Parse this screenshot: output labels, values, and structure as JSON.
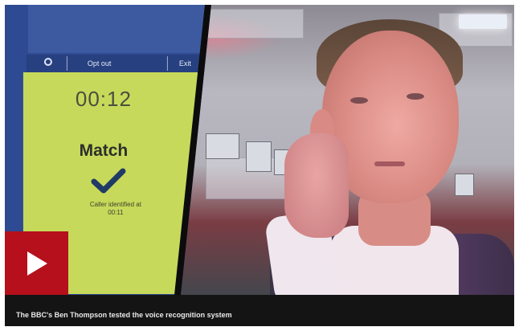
{
  "screen": {
    "toolbar": {
      "opt_out_label": "Opt out",
      "exit_label": "Exit"
    },
    "timer": "00:12",
    "status": "Match",
    "caller_line1": "Caller identified at",
    "caller_line2": "00:11"
  },
  "player": {
    "play_label": "Play video",
    "caption": "The BBC's Ben Thompson tested the voice recognition system"
  },
  "colors": {
    "play_button": "#b5101b",
    "screen_panel": "#c7d95a",
    "caption_bar": "#141414"
  }
}
